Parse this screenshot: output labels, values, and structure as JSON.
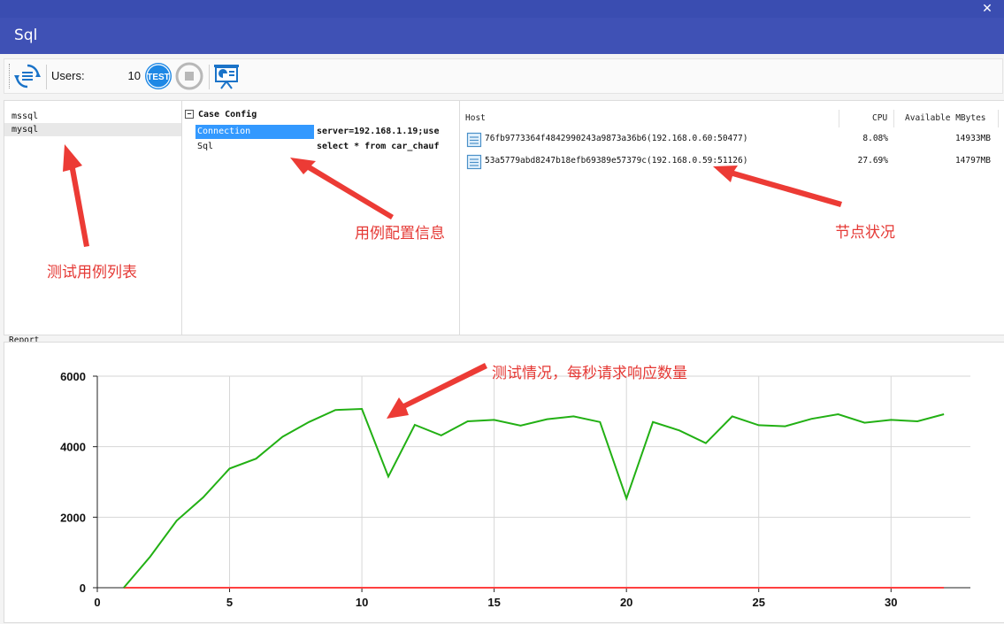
{
  "window": {
    "close_glyph": "✕",
    "title": "Sql"
  },
  "toolbar": {
    "users_label": "Users:",
    "users_value": "10",
    "refresh_icon": "refresh-icon",
    "test_icon": "test-icon",
    "test_label": "TEST",
    "stop_icon": "stop-icon",
    "report_icon": "presentation-icon"
  },
  "cases": {
    "items": [
      "mssql",
      "mysql"
    ],
    "selected": "mysql"
  },
  "config": {
    "header": "Case Config",
    "toggle": "−",
    "rows": [
      {
        "key": "Connection",
        "value": "server=192.168.1.19;use"
      },
      {
        "key": "Sql",
        "value": "select * from car_chauf"
      }
    ]
  },
  "nodes": {
    "columns": [
      "Host",
      "CPU",
      "Available MBytes"
    ],
    "rows": [
      {
        "host": "76fb9773364f4842990243a9873a36b6(192.168.0.60:50477)",
        "cpu": "8.08%",
        "mem": "14933MB"
      },
      {
        "host": "53a5779abd8247b18efb69389e57379c(192.168.0.59:51126)",
        "cpu": "27.69%",
        "mem": "14797MB"
      }
    ]
  },
  "report": {
    "label": "Report"
  },
  "annotations": {
    "case_list": "测试用例列表",
    "case_config": "用例配置信息",
    "node_status": "节点状况",
    "test_status": "测试情况，每秒请求响应数量"
  },
  "colors": {
    "titlebar": "#3f51b5",
    "accent": "#3399ff",
    "annotation": "#e53935",
    "series_green": "#22b014",
    "series_red": "#ff4040"
  },
  "chart_data": {
    "type": "line",
    "x": [
      1,
      2,
      3,
      4,
      5,
      6,
      7,
      8,
      9,
      10,
      11,
      12,
      13,
      14,
      15,
      16,
      17,
      18,
      19,
      20,
      21,
      22,
      23,
      24,
      25,
      26,
      27,
      28,
      29,
      30,
      31,
      32
    ],
    "series": [
      {
        "values": [
          0,
          880,
          1900,
          2560,
          3380,
          3660,
          4280,
          4700,
          5040,
          5070,
          3150,
          4620,
          4320,
          4720,
          4760,
          4600,
          4780,
          4860,
          4700,
          2530,
          4700,
          4460,
          4100,
          4860,
          4610,
          4580,
          4790,
          4920,
          4680,
          4760,
          4720,
          4920
        ]
      },
      {
        "values": [
          0,
          0,
          0,
          0,
          0,
          0,
          0,
          0,
          0,
          0,
          0,
          0,
          0,
          0,
          0,
          0,
          0,
          0,
          0,
          0,
          0,
          0,
          0,
          0,
          0,
          0,
          0,
          0,
          0,
          0,
          0,
          0
        ]
      }
    ],
    "xlim": [
      0,
      33
    ],
    "ylim": [
      0,
      6000
    ],
    "xticks": [
      0,
      5,
      10,
      15,
      20,
      25,
      30
    ],
    "yticks": [
      0,
      2000,
      4000,
      6000
    ],
    "grid": true
  }
}
